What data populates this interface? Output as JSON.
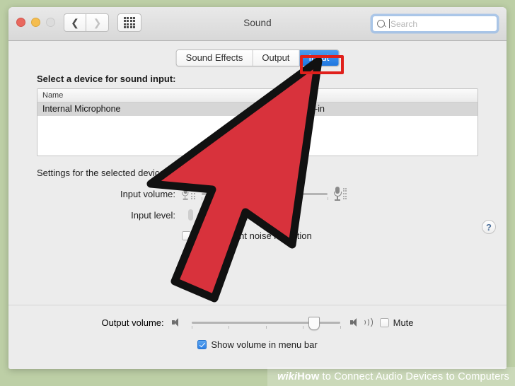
{
  "window": {
    "title": "Sound",
    "traffic_lights": [
      "close",
      "minimize",
      "zoom-disabled"
    ],
    "nav": {
      "back_icon": "chevron-left-icon",
      "forward_icon": "chevron-right-icon",
      "grid_icon": "show-all-icon"
    },
    "search": {
      "placeholder": "Search",
      "value": "",
      "icon": "search-icon"
    }
  },
  "tabs": [
    {
      "label": "Sound Effects",
      "selected": false
    },
    {
      "label": "Output",
      "selected": false
    },
    {
      "label": "Input",
      "selected": true
    }
  ],
  "device_section": {
    "label": "Select a device for sound input:",
    "columns": [
      "Name",
      "Type"
    ],
    "rows": [
      {
        "name": "Internal Microphone",
        "type": "Built-in",
        "selected": true
      }
    ]
  },
  "settings": {
    "label": "Settings for the selected device:",
    "input_volume": {
      "label": "Input volume:",
      "value_percent": 75,
      "left_icon": "microphone-small-icon",
      "right_icon": "microphone-large-icon",
      "tick_count": 5
    },
    "input_level": {
      "label": "Input level:",
      "segments": 10,
      "active_segments": 0
    },
    "ambient_noise": {
      "label": "Use ambient noise reduction",
      "visible_label": "mbient noise reduction",
      "checked": false
    },
    "help_icon": "question-mark-icon",
    "help_label": "?"
  },
  "bottom": {
    "output_volume": {
      "label": "Output volume:",
      "value_percent": 82,
      "mute_icon": "speaker-low-icon",
      "loud_icon": "speaker-high-icon",
      "tick_count": 5
    },
    "mute": {
      "label": "Mute",
      "checked": false
    },
    "show_in_menu_bar": {
      "label": "Show volume in menu bar",
      "checked": true
    }
  },
  "annotations": {
    "highlight_target": "Input",
    "highlight_color": "#e0201b",
    "cursor_arrow": {
      "fill": "#d8323c",
      "stroke": "#111111",
      "points_at": "Input"
    }
  },
  "watermark": {
    "wiki": "wiki",
    "how": "How",
    "rest": "to Connect Audio Devices to Computers"
  },
  "colors": {
    "desktop": "#bdcfa6",
    "window_bg": "#ececec",
    "tab_selected": "#2f85e8",
    "annotation_red": "#e0201b",
    "arrow_red": "#d8323c"
  }
}
